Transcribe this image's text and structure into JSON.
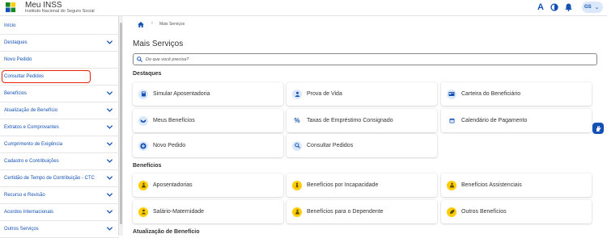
{
  "header": {
    "title": "Meu INSS",
    "subtitle": "Instituto Nacional do Seguro Social",
    "contrast_icon": "contrast-icon",
    "font_icon_label": "A",
    "avatar_initials": "GS",
    "brand_color": "#1351b4"
  },
  "sidebar": {
    "items": [
      {
        "label": "Início",
        "has_chevron": false
      },
      {
        "label": "Destaques",
        "has_chevron": true
      },
      {
        "label": "Novo Pedido",
        "has_chevron": false
      },
      {
        "label": "Consultar Pedidos",
        "has_chevron": false,
        "highlighted": true
      },
      {
        "label": "Benefícios",
        "has_chevron": true
      },
      {
        "label": "Atualização de Benefício",
        "has_chevron": true
      },
      {
        "label": "Extratos e Comprovantes",
        "has_chevron": true
      },
      {
        "label": "Cumprimento de Exigência",
        "has_chevron": true
      },
      {
        "label": "Cadastro e Contribuições",
        "has_chevron": true
      },
      {
        "label": "Certidão de Tempo de Contribuição - CTC",
        "has_chevron": true
      },
      {
        "label": "Recurso e Revisão",
        "has_chevron": true
      },
      {
        "label": "Acordos Internacionais",
        "has_chevron": true
      },
      {
        "label": "Outros Serviços",
        "has_chevron": true
      }
    ],
    "highlight_color": "#e52207"
  },
  "breadcrumb": {
    "home_icon": "home-icon",
    "current": "Mais Serviços"
  },
  "page": {
    "title": "Mais Serviços",
    "search_placeholder": "Do que você precisa?"
  },
  "sections": [
    {
      "title": "Destaques",
      "cards": [
        {
          "label": "Simular Aposentadoria",
          "icon": "calculator-icon",
          "icon_style": "blue"
        },
        {
          "label": "Prova de Vida",
          "icon": "person-icon",
          "icon_style": "blue"
        },
        {
          "label": "Carteira do Beneficiário",
          "icon": "id-card-icon",
          "icon_style": "blue"
        },
        {
          "label": "Meus Benefícios",
          "icon": "wings-icon",
          "icon_style": "blue"
        },
        {
          "label": "Taxas de Empréstimo Consignado",
          "icon": "percent-icon",
          "icon_style": "blue"
        },
        {
          "label": "Calendário de Pagamento",
          "icon": "calendar-icon",
          "icon_style": "blue"
        },
        {
          "label": "Novo Pedido",
          "icon": "plus-icon",
          "icon_style": "blue"
        },
        {
          "label": "Consultar Pedidos",
          "icon": "search-icon",
          "icon_style": "blue"
        }
      ]
    },
    {
      "title": "Benefícios",
      "cards": [
        {
          "label": "Aposentadorias",
          "icon": "retiree-icon",
          "icon_style": "yellow"
        },
        {
          "label": "Benefícios por Incapacidade",
          "icon": "crutch-icon",
          "icon_style": "yellow"
        },
        {
          "label": "Benefícios Assistenciais",
          "icon": "assist-icon",
          "icon_style": "yellow"
        },
        {
          "label": "Salário-Maternidade",
          "icon": "baby-icon",
          "icon_style": "yellow"
        },
        {
          "label": "Benefícios para o Dependente",
          "icon": "dependent-icon",
          "icon_style": "yellow"
        },
        {
          "label": "Outros Benefícios",
          "icon": "leaf-icon",
          "icon_style": "yellow"
        }
      ]
    },
    {
      "title": "Atualização de Benefício",
      "cards": []
    }
  ]
}
